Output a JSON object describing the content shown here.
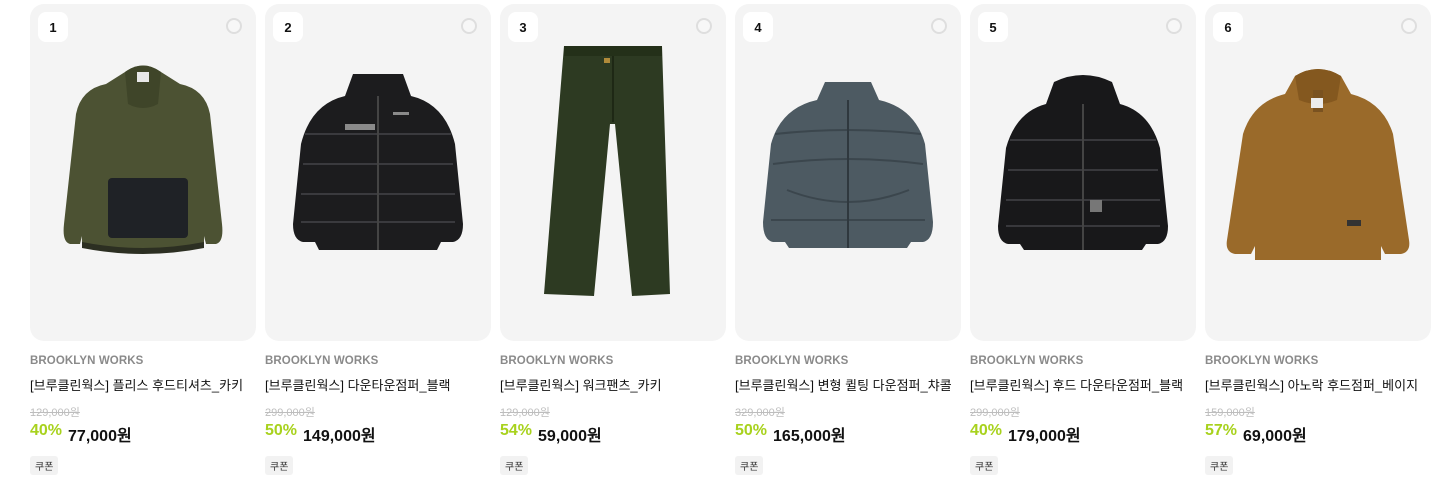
{
  "products": [
    {
      "rank": "1",
      "brand": "BROOKLYN WORKS",
      "title": "[브루클린웍스] 플리스 후드티셔츠_카키",
      "original_price": "129,000원",
      "discount": "40%",
      "sale_price": "77,000원",
      "badge": "쿠폰",
      "image_icon": "khaki-fleece-hoodie-icon",
      "color": "#4c5233"
    },
    {
      "rank": "2",
      "brand": "BROOKLYN WORKS",
      "title": "[브루클린웍스] 다운타운점퍼_블랙",
      "original_price": "299,000원",
      "discount": "50%",
      "sale_price": "149,000원",
      "badge": "쿠폰",
      "image_icon": "black-puffer-jacket-icon",
      "color": "#1c1c1e"
    },
    {
      "rank": "3",
      "brand": "BROOKLYN WORKS",
      "title": "[브루클린웍스] 워크팬츠_카키",
      "original_price": "129,000원",
      "discount": "54%",
      "sale_price": "59,000원",
      "badge": "쿠폰",
      "image_icon": "khaki-work-pants-icon",
      "color": "#2d3a22"
    },
    {
      "rank": "4",
      "brand": "BROOKLYN WORKS",
      "title": "[브루클린웍스] 변형 퀼팅 다운점퍼_챠콜",
      "original_price": "329,000원",
      "discount": "50%",
      "sale_price": "165,000원",
      "badge": "쿠폰",
      "image_icon": "charcoal-quilted-down-jacket-icon",
      "color": "#4d5a62"
    },
    {
      "rank": "5",
      "brand": "BROOKLYN WORKS",
      "title": "[브루클린웍스] 후드 다운타운점퍼_블랙",
      "original_price": "299,000원",
      "discount": "40%",
      "sale_price": "179,000원",
      "badge": "쿠폰",
      "image_icon": "black-hooded-puffer-jacket-icon",
      "color": "#18181a"
    },
    {
      "rank": "6",
      "brand": "BROOKLYN WORKS",
      "title": "[브루클린웍스] 아노락 후드점퍼_베이지",
      "original_price": "159,000원",
      "discount": "57%",
      "sale_price": "69,000원",
      "badge": "쿠폰",
      "image_icon": "beige-anorak-hoodie-icon",
      "color": "#9a6a2a"
    }
  ],
  "colors": {
    "discount": "#a8d21d",
    "thumb_bg": "#f4f4f4",
    "brand_text": "#8a8a8a"
  }
}
